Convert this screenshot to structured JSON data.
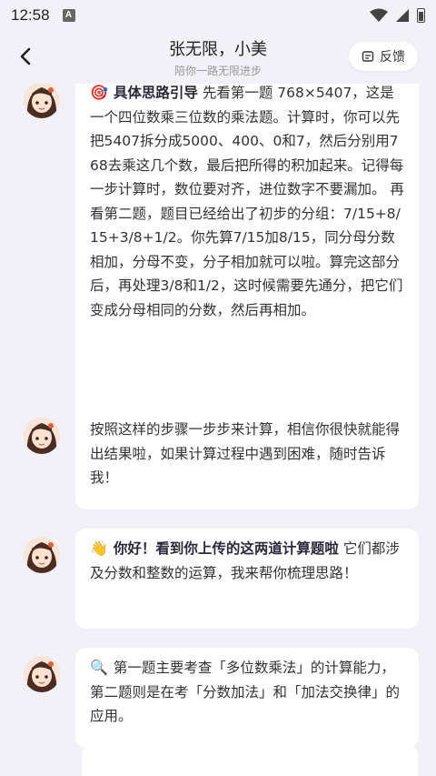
{
  "status": {
    "time": "12:58",
    "notification_badge": "A"
  },
  "header": {
    "title": "张无限，小美",
    "subtitle": "陪你一路无限进步",
    "feedback_label": "反馈"
  },
  "messages": [
    {
      "emoji": "🎯",
      "bold": "具体思路引导",
      "text": " 先看第一题 768×5407，这是一个四位数乘三位数的乘法题。计算时，你可以先把5407拆分成5000、400、0和7，然后分别用768去乘这几个数，最后把所得的积加起来。记得每一步计算时，数位要对齐，进位数字不要漏加。 再看第二题，题目已经给出了初步的分组：7/15+8/15+3/8+1/2。你先算7/15加8/15，同分母分数相加，分母不变，分子相加就可以啦。算完这部分后，再处理3/8和1/2，这时候需要先通分，把它们变成分母相同的分数，然后再相加。"
    },
    {
      "emoji": "",
      "bold": "",
      "text": "按照这样的步骤一步步来计算，相信你很快就能得出结果啦，如果计算过程中遇到困难，随时告诉我！"
    },
    {
      "emoji": "👋",
      "bold": "你好！看到你上传的这两道计算题啦",
      "text": " 它们都涉及分数和整数的运算，我来帮你梳理思路！"
    },
    {
      "emoji": "🔍",
      "bold": "",
      "text": "第一题主要考查「多位数乘法」的计算能力，第二题则是在考「分数加法」和「加法交换律」的应用。"
    }
  ]
}
